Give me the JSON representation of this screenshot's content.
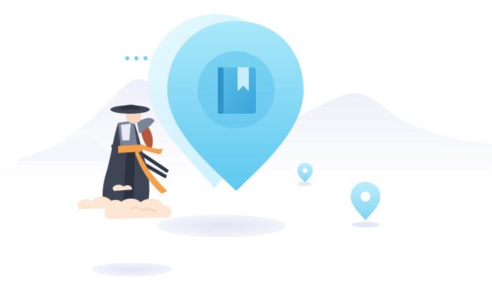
{
  "illustration": {
    "subject": "samurai-wanderer-with-location-pin",
    "main_pin_icon": "bookmark-book-icon",
    "secondary_pins": [
      "small-location-pin-icon",
      "medium-location-pin-icon"
    ],
    "decorations": [
      "three-dots",
      "mountains",
      "clouds",
      "ground-shadows"
    ]
  },
  "colors": {
    "pin_light": "#c9f0fb",
    "pin_main": "#7ad6f4",
    "pin_dark": "#3fb6e6",
    "book": "#4fb4e2",
    "mountain": "#f1f3fb",
    "shadow": "#e6e8f5",
    "robe": "#3e4656",
    "sash": "#f2a04a",
    "cloud": "#fde2cc"
  }
}
